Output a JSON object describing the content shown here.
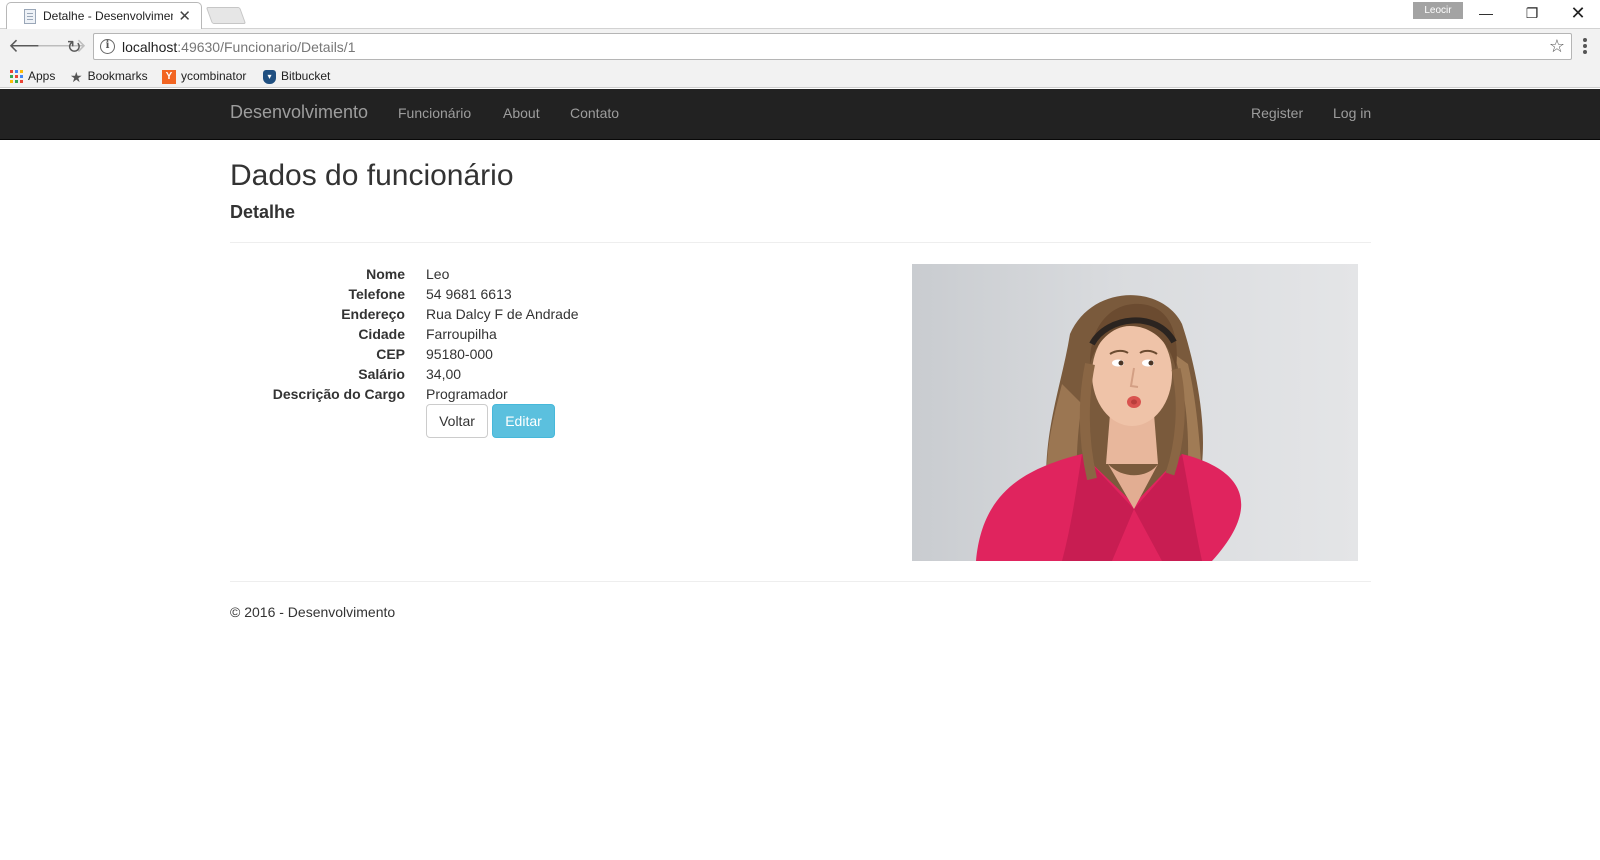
{
  "browser": {
    "tab_title": "Detalhe - Desenvolvimento",
    "tab_close": "✕",
    "user_badge": "Leocir",
    "url_host": "localhost",
    "url_path": ":49630/Funcionario/Details/1",
    "bookmarks": [
      {
        "label": "Apps",
        "icon": "apps-grid-icon"
      },
      {
        "label": "Bookmarks",
        "icon": "star-icon"
      },
      {
        "label": "ycombinator",
        "icon": "ycombinator-icon"
      },
      {
        "label": "Bitbucket",
        "icon": "bitbucket-icon"
      }
    ],
    "window_controls": {
      "minimize": "—",
      "maximize": "❐",
      "close": "✕"
    }
  },
  "navbar": {
    "brand": "Desenvolvimento",
    "links": [
      "Funcionário",
      "About",
      "Contato"
    ],
    "right_links": [
      "Register",
      "Log in"
    ]
  },
  "page": {
    "title": "Dados do funcionário",
    "subtitle": "Detalhe"
  },
  "details": [
    {
      "label": "Nome",
      "value": "Leo"
    },
    {
      "label": "Telefone",
      "value": "54 9681 6613"
    },
    {
      "label": "Endereço",
      "value": "Rua Dalcy F de Andrade"
    },
    {
      "label": "Cidade",
      "value": "Farroupilha"
    },
    {
      "label": "CEP",
      "value": "95180-000"
    },
    {
      "label": "Salário",
      "value": "34,00"
    },
    {
      "label": "Descrição do Cargo",
      "value": "Programador"
    }
  ],
  "buttons": {
    "back": "Voltar",
    "edit": "Editar"
  },
  "footer": {
    "text": "© 2016 - Desenvolvimento"
  },
  "colors": {
    "navbar_bg": "#222222",
    "navbar_text": "#9d9d9d",
    "edit_button": "#5bc0de",
    "photo_shirt": "#e0245e"
  }
}
